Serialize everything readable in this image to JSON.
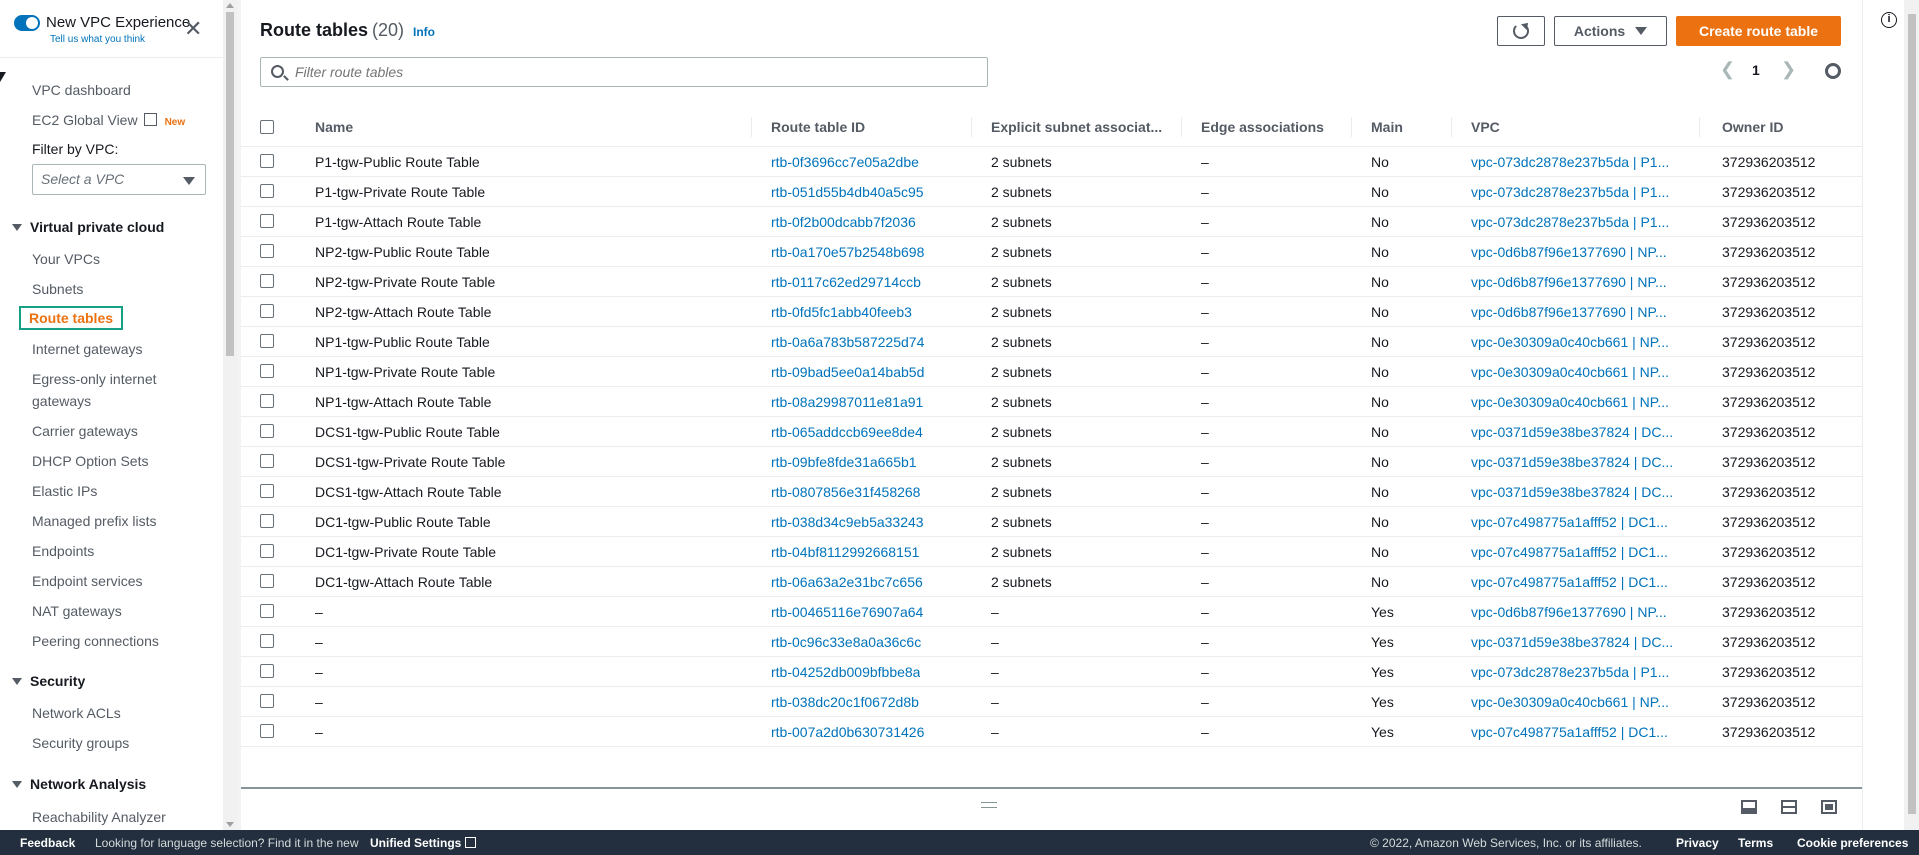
{
  "sidebar": {
    "toggle_label": "New VPC Experience",
    "feedback_link": "Tell us what you think",
    "close_label": "✕",
    "vpc_dashboard": "VPC dashboard",
    "ec2_global_view": "EC2 Global View",
    "new_badge": "New",
    "filter_label": "Filter by VPC:",
    "filter_placeholder": "Select a VPC",
    "section_vpc": "Virtual private cloud",
    "section_security": "Security",
    "section_network_analysis": "Network Analysis",
    "items": [
      "Your VPCs",
      "Subnets",
      "Route tables",
      "Internet gateways",
      "Egress-only internet",
      "gateways",
      "Carrier gateways",
      "DHCP Option Sets",
      "Elastic IPs",
      "Managed prefix lists",
      "Endpoints",
      "Endpoint services",
      "NAT gateways",
      "Peering connections"
    ],
    "security_items": [
      "Network ACLs",
      "Security groups"
    ],
    "network_items": [
      "Reachability Analyzer"
    ]
  },
  "header": {
    "title": "Route tables",
    "count": "(20)",
    "info": "Info",
    "actions_label": "Actions",
    "create_label": "Create route table",
    "filter_placeholder": "Filter route tables",
    "page": "1",
    "prev": "❮",
    "next": "❯"
  },
  "table": {
    "columns": [
      "Name",
      "Route table ID",
      "Explicit subnet associat...",
      "Edge associations",
      "Main",
      "VPC",
      "Owner ID"
    ],
    "rows": [
      {
        "name": "P1-tgw-Public Route Table",
        "id": "rtb-0f3696cc7e05a2dbe",
        "subnets": "2 subnets",
        "edge": "–",
        "main": "No",
        "vpc": "vpc-073dc2878e237b5da | P1...",
        "owner": "372936203512"
      },
      {
        "name": "P1-tgw-Private Route Table",
        "id": "rtb-051d55b4db40a5c95",
        "subnets": "2 subnets",
        "edge": "–",
        "main": "No",
        "vpc": "vpc-073dc2878e237b5da | P1...",
        "owner": "372936203512"
      },
      {
        "name": "P1-tgw-Attach Route Table",
        "id": "rtb-0f2b00dcabb7f2036",
        "subnets": "2 subnets",
        "edge": "–",
        "main": "No",
        "vpc": "vpc-073dc2878e237b5da | P1...",
        "owner": "372936203512"
      },
      {
        "name": "NP2-tgw-Public Route Table",
        "id": "rtb-0a170e57b2548b698",
        "subnets": "2 subnets",
        "edge": "–",
        "main": "No",
        "vpc": "vpc-0d6b87f96e1377690 | NP...",
        "owner": "372936203512"
      },
      {
        "name": "NP2-tgw-Private Route Table",
        "id": "rtb-0117c62ed29714ccb",
        "subnets": "2 subnets",
        "edge": "–",
        "main": "No",
        "vpc": "vpc-0d6b87f96e1377690 | NP...",
        "owner": "372936203512"
      },
      {
        "name": "NP2-tgw-Attach Route Table",
        "id": "rtb-0fd5fc1abb40feeb3",
        "subnets": "2 subnets",
        "edge": "–",
        "main": "No",
        "vpc": "vpc-0d6b87f96e1377690 | NP...",
        "owner": "372936203512"
      },
      {
        "name": "NP1-tgw-Public Route Table",
        "id": "rtb-0a6a783b587225d74",
        "subnets": "2 subnets",
        "edge": "–",
        "main": "No",
        "vpc": "vpc-0e30309a0c40cb661 | NP...",
        "owner": "372936203512"
      },
      {
        "name": "NP1-tgw-Private Route Table",
        "id": "rtb-09bad5ee0a14bab5d",
        "subnets": "2 subnets",
        "edge": "–",
        "main": "No",
        "vpc": "vpc-0e30309a0c40cb661 | NP...",
        "owner": "372936203512"
      },
      {
        "name": "NP1-tgw-Attach Route Table",
        "id": "rtb-08a29987011e81a91",
        "subnets": "2 subnets",
        "edge": "–",
        "main": "No",
        "vpc": "vpc-0e30309a0c40cb661 | NP...",
        "owner": "372936203512"
      },
      {
        "name": "DCS1-tgw-Public Route Table",
        "id": "rtb-065addccb69ee8de4",
        "subnets": "2 subnets",
        "edge": "–",
        "main": "No",
        "vpc": "vpc-0371d59e38be37824 | DC...",
        "owner": "372936203512"
      },
      {
        "name": "DCS1-tgw-Private Route Table",
        "id": "rtb-09bfe8fde31a665b1",
        "subnets": "2 subnets",
        "edge": "–",
        "main": "No",
        "vpc": "vpc-0371d59e38be37824 | DC...",
        "owner": "372936203512"
      },
      {
        "name": "DCS1-tgw-Attach Route Table",
        "id": "rtb-0807856e31f458268",
        "subnets": "2 subnets",
        "edge": "–",
        "main": "No",
        "vpc": "vpc-0371d59e38be37824 | DC...",
        "owner": "372936203512"
      },
      {
        "name": "DC1-tgw-Public Route Table",
        "id": "rtb-038d34c9eb5a33243",
        "subnets": "2 subnets",
        "edge": "–",
        "main": "No",
        "vpc": "vpc-07c498775a1afff52 | DC1...",
        "owner": "372936203512"
      },
      {
        "name": "DC1-tgw-Private Route Table",
        "id": "rtb-04bf8112992668151",
        "subnets": "2 subnets",
        "edge": "–",
        "main": "No",
        "vpc": "vpc-07c498775a1afff52 | DC1...",
        "owner": "372936203512"
      },
      {
        "name": "DC1-tgw-Attach Route Table",
        "id": "rtb-06a63a2e31bc7c656",
        "subnets": "2 subnets",
        "edge": "–",
        "main": "No",
        "vpc": "vpc-07c498775a1afff52 | DC1...",
        "owner": "372936203512"
      },
      {
        "name": "–",
        "id": "rtb-00465116e76907a64",
        "subnets": "–",
        "edge": "–",
        "main": "Yes",
        "vpc": "vpc-0d6b87f96e1377690 | NP...",
        "owner": "372936203512"
      },
      {
        "name": "–",
        "id": "rtb-0c96c33e8a0a36c6c",
        "subnets": "–",
        "edge": "–",
        "main": "Yes",
        "vpc": "vpc-0371d59e38be37824 | DC...",
        "owner": "372936203512"
      },
      {
        "name": "–",
        "id": "rtb-04252db009bfbbe8a",
        "subnets": "–",
        "edge": "–",
        "main": "Yes",
        "vpc": "vpc-073dc2878e237b5da | P1...",
        "owner": "372936203512"
      },
      {
        "name": "–",
        "id": "rtb-038dc20c1f0672d8b",
        "subnets": "–",
        "edge": "–",
        "main": "Yes",
        "vpc": "vpc-0e30309a0c40cb661 | NP...",
        "owner": "372936203512"
      },
      {
        "name": "–",
        "id": "rtb-007a2d0b630731426",
        "subnets": "–",
        "edge": "–",
        "main": "Yes",
        "vpc": "vpc-07c498775a1afff52 | DC1...",
        "owner": "372936203512"
      }
    ]
  },
  "footer": {
    "feedback": "Feedback",
    "language_note": "Looking for language selection? Find it in the new",
    "unified_settings": "Unified Settings",
    "copyright": "© 2022, Amazon Web Services, Inc. or its affiliates.",
    "privacy": "Privacy",
    "terms": "Terms",
    "cookies": "Cookie preferences"
  },
  "colors": {
    "accent": "#ec7211",
    "link": "#0073bb",
    "footer_bg": "#232f3e",
    "active_outline": "#16a085"
  },
  "icons": [
    "close-icon",
    "external-link-icon",
    "refresh-icon",
    "search-icon",
    "gear-icon",
    "info-icon"
  ]
}
